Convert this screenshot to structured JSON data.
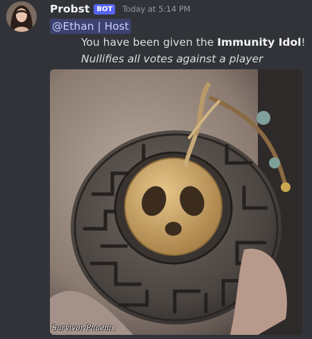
{
  "message": {
    "author": "Probst",
    "bot_tag": "BOT",
    "timestamp": "Today at 5:14 PM",
    "mention": "@Ethan | Host",
    "text_before": "You have been given the ",
    "text_bold": "Immunity Idol",
    "text_after": "!",
    "italic_line": "Nullifies all votes against a player"
  },
  "image": {
    "watermark": "Survivor Phoenix",
    "subject": "immunity-idol-medallion"
  },
  "colors": {
    "background": "#313338",
    "mention_bg": "#3c4270",
    "mention_text": "#c9cdfb",
    "bot_tag": "#5865f2"
  }
}
